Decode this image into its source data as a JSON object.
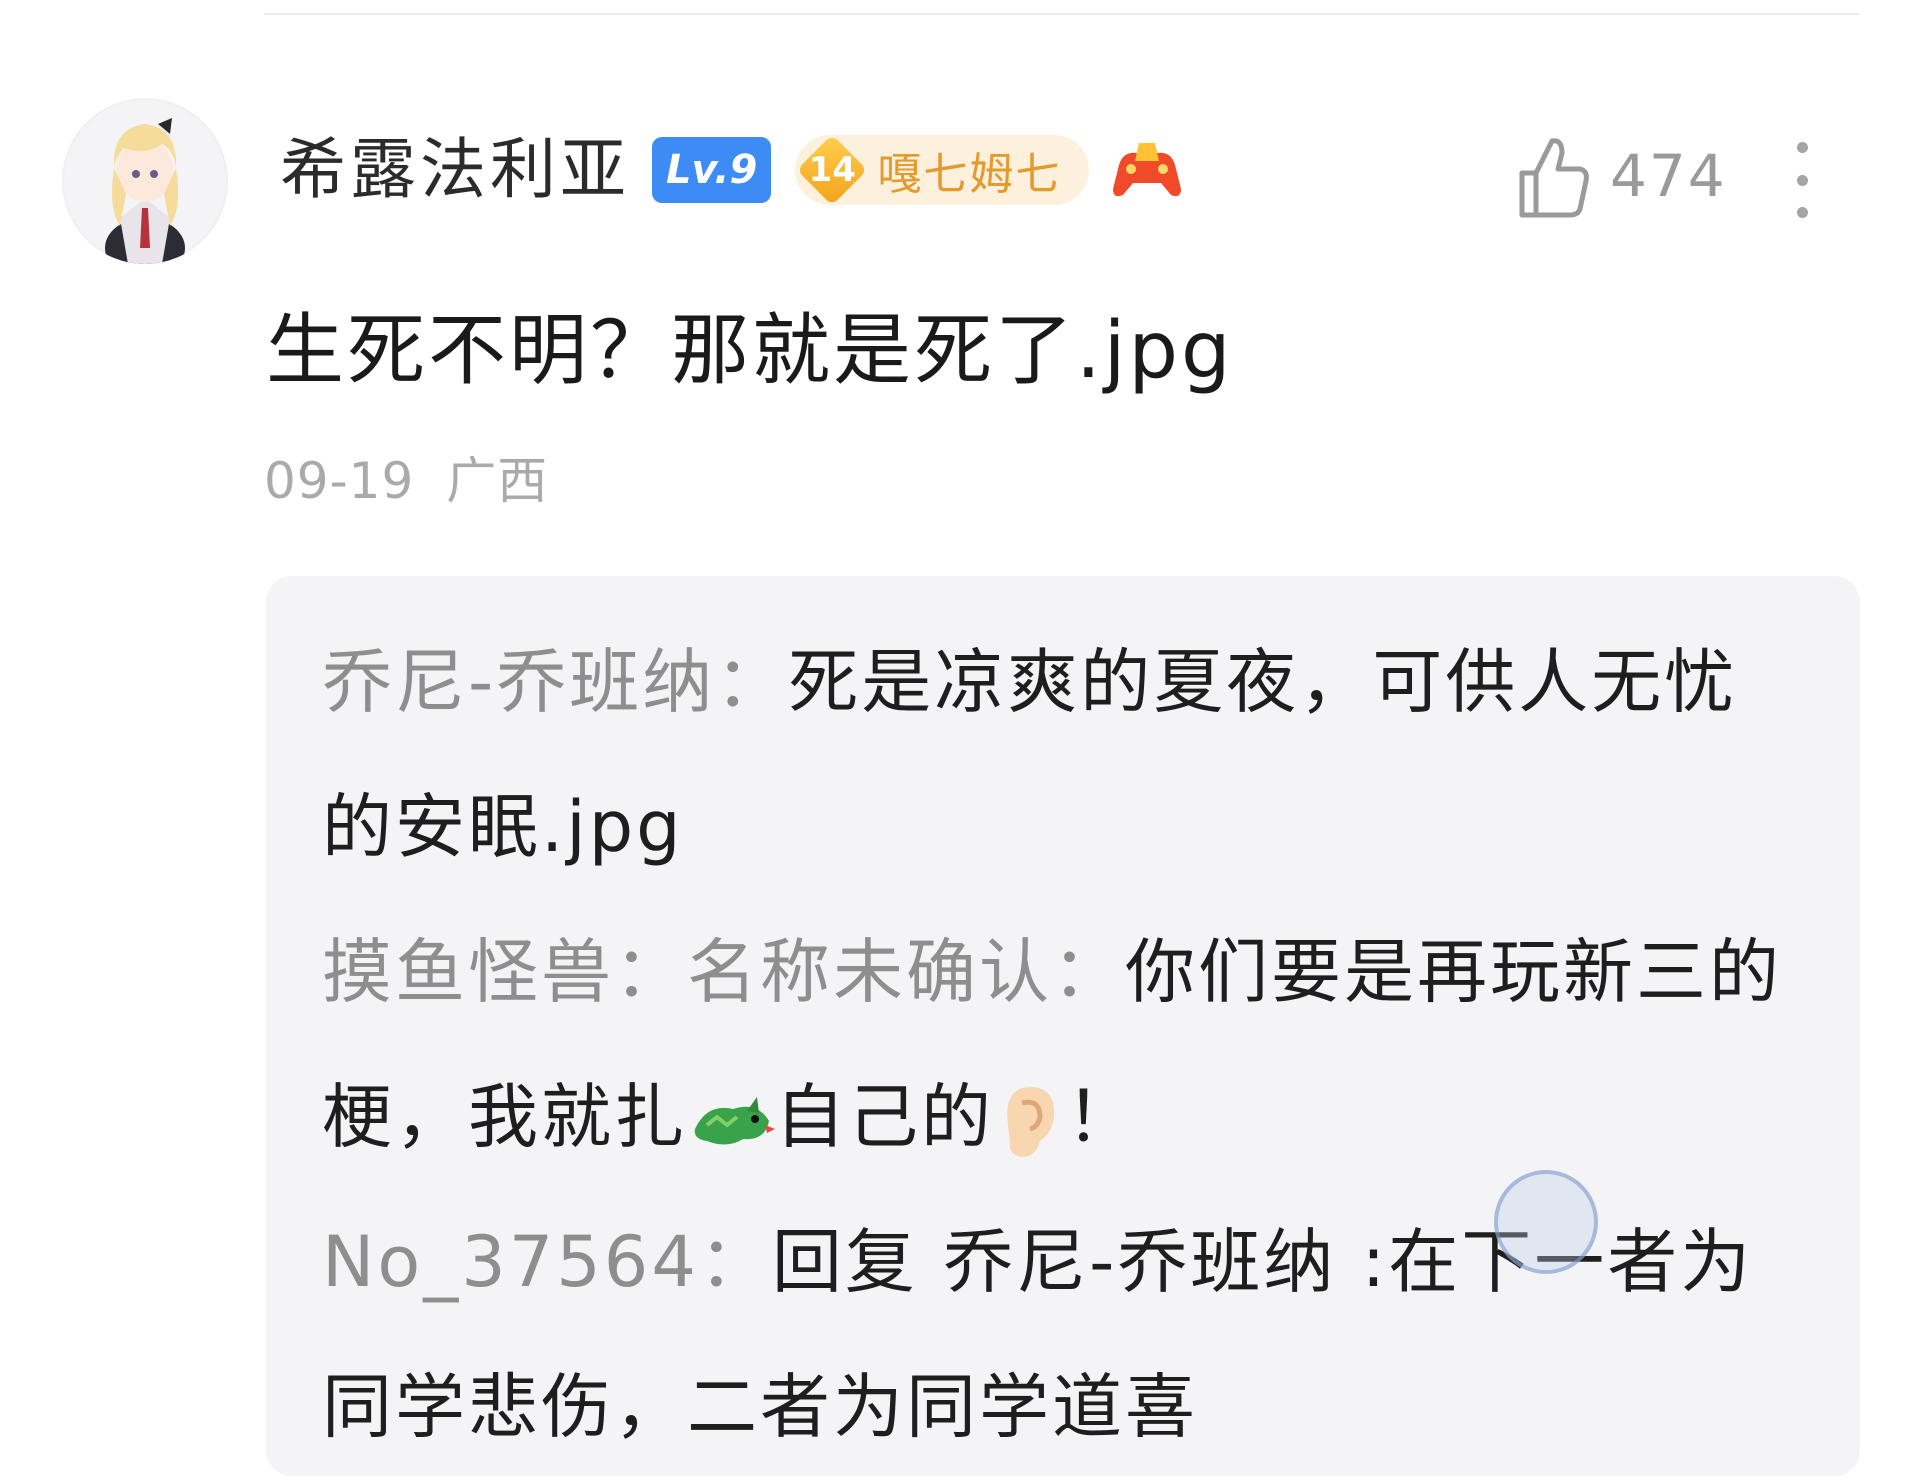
{
  "comment": {
    "username": "希露法利亚",
    "level_badge": "Lv.9",
    "medal": {
      "level": "14",
      "name": "嘎七姆七"
    },
    "like_count": "474",
    "text": "生死不明？那就是死了.jpg",
    "date": "09-19",
    "location": "广西"
  },
  "replies": [
    {
      "author": "乔尼-乔班纳：",
      "text": "死是凉爽的夏夜，可供人无忧的安眠.jpg"
    },
    {
      "author": "摸鱼怪兽：名称未确认：",
      "text_before": "你们要是再玩新三的梗，我就扎",
      "text_middle": "自己的",
      "text_after": "！",
      "emoji_1": "dragon-emoji",
      "emoji_2": "ear-emoji"
    },
    {
      "author": "No_37564：",
      "text": "回复 乔尼-乔班纳 :在下一者为同学悲伤，二者为同学道喜"
    }
  ],
  "colors": {
    "level_badge": "#3d8cf5",
    "medal": "#f3a21b",
    "reply_bg": "#f4f4f6",
    "author_gray": "#8e8e8e"
  },
  "icons": [
    "avatar",
    "diamond-medal-icon",
    "gamepad-icon",
    "thumbs-up-icon",
    "more-vertical-icon"
  ]
}
